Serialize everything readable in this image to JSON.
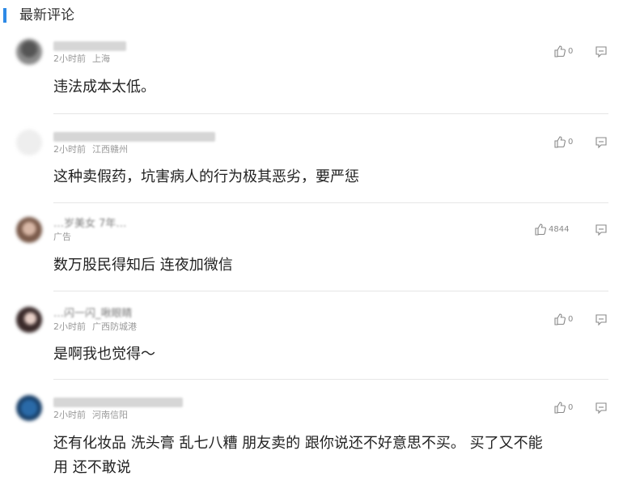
{
  "header": {
    "title": "最新评论"
  },
  "comments": [
    {
      "username": "",
      "time": "2小时前",
      "location": "上海",
      "text": "违法成本太低。",
      "likes": "0"
    },
    {
      "username": "",
      "time": "2小时前",
      "location": "江西赣州",
      "text": "这种卖假药，坑害病人的行为极其恶劣，要严惩",
      "likes": "0"
    },
    {
      "username": "…岁美女 7年…",
      "time": "",
      "location": "广告",
      "text": "数万股民得知后 连夜加微信",
      "likes": "4844"
    },
    {
      "username": "…闪一闪_啾眼睛",
      "time": "2小时前",
      "location": "广西防城港",
      "text": "是啊我也觉得～",
      "likes": "0"
    },
    {
      "username": "",
      "time": "2小时前",
      "location": "河南信阳",
      "text_line1": "还有化妆品 洗头膏 乱七八糟 朋友卖的 跟你说还不好意思不买。 买了又不能",
      "text_line2": "用 还不敢说",
      "likes": "0"
    }
  ],
  "colors": {
    "accent": "#2e8ae6",
    "text": "#222222",
    "meta": "#999999",
    "divider": "#e6e6e6"
  },
  "icons": {
    "like": "thumbs-up-icon",
    "reply": "reply-bubble-icon"
  }
}
